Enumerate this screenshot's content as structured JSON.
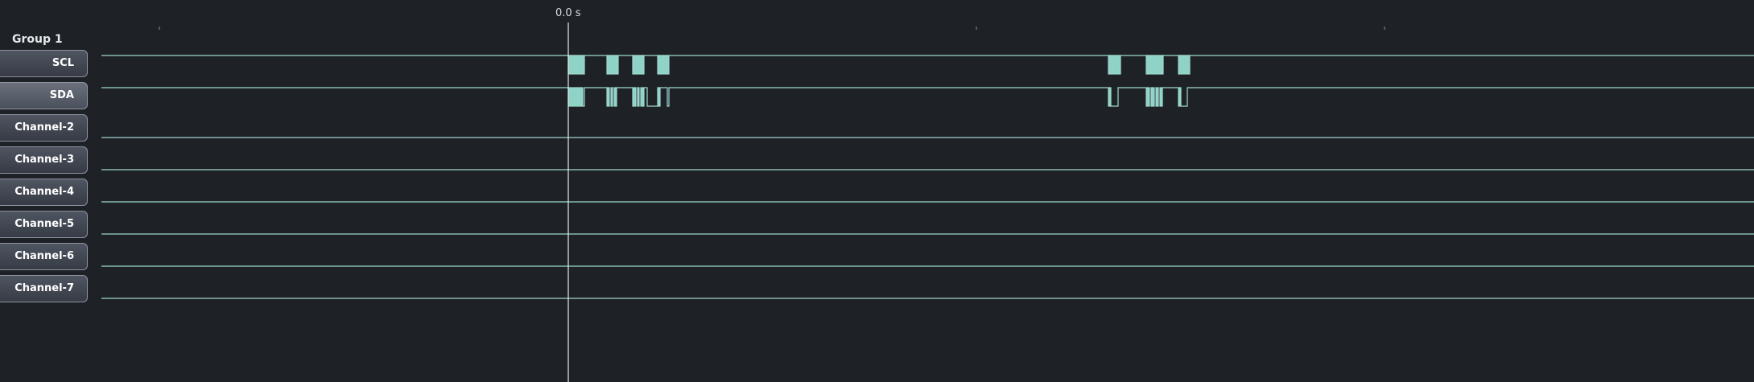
{
  "timeline": {
    "cursor_label": "0.0 s"
  },
  "group": {
    "label": "Group 1"
  },
  "channels": [
    {
      "label": "SCL",
      "selected": false
    },
    {
      "label": "SDA",
      "selected": true
    },
    {
      "label": "Channel-2",
      "selected": false
    },
    {
      "label": "Channel-3",
      "selected": false
    },
    {
      "label": "Channel-4",
      "selected": false
    },
    {
      "label": "Channel-5",
      "selected": false
    },
    {
      "label": "Channel-6",
      "selected": false
    },
    {
      "label": "Channel-7",
      "selected": false
    }
  ],
  "colors": {
    "background": "#1e2126",
    "trace": "#9fd8cf",
    "trace_fill": "#8fd3c7",
    "cursor": "#e8eaee"
  }
}
